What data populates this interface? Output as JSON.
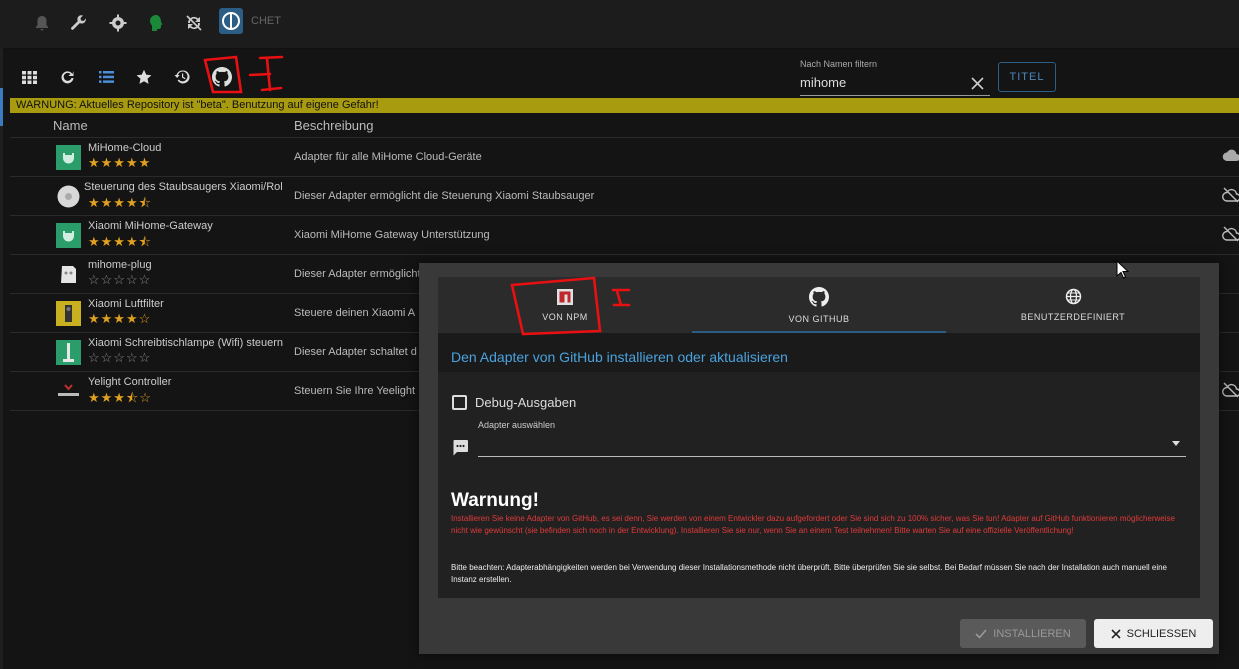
{
  "topbar": {
    "icons": [
      "bell-icon",
      "wrench-icon",
      "gear-icon",
      "hazard-icon",
      "sync-icon"
    ],
    "logo_text": "CHET"
  },
  "toolbar": {
    "icons": [
      "grid-icon",
      "refresh-icon",
      "list-icon",
      "star-icon",
      "history-icon",
      "github-icon"
    ],
    "filter_label": "Nach Namen filtern",
    "filter_value": "mihome",
    "title_button": "TITEL"
  },
  "warning_bar": "WARNUNG: Aktuelles Repository ist \"beta\". Benutzung auf eigene Gefahr!",
  "table": {
    "headers": {
      "name": "Name",
      "description": "Beschreibung"
    },
    "rows": [
      {
        "name": "MiHome-Cloud",
        "rating": 5.0,
        "stars": "★★★★★",
        "description": "Adapter für alle MiHome Cloud-Geräte",
        "icon": "mihome-icon",
        "cloud": "cloud-icon"
      },
      {
        "name": "Steuerung des Staubsaugers Xiaomi/Rol",
        "rating": 4.5,
        "stars": "★★★★⯪",
        "description": "Dieser Adapter ermöglicht die Steuerung Xiaomi Staubsauger",
        "icon": "vacuum-icon",
        "cloud": "cloud-off-icon"
      },
      {
        "name": "Xiaomi MiHome-Gateway",
        "rating": 4.5,
        "stars": "★★★★⯪",
        "description": "Xiaomi MiHome Gateway Unterstützung",
        "icon": "mihome-icon",
        "cloud": "cloud-off-icon"
      },
      {
        "name": "mihome-plug",
        "rating": 0,
        "stars": "☆☆☆☆☆",
        "description": "Dieser Adapter ermöglicht",
        "icon": "plug-icon",
        "cloud": ""
      },
      {
        "name": "Xiaomi Luftfilter",
        "rating": 4.0,
        "stars": "★★★★☆",
        "description": "Steuere deinen Xiaomi A",
        "icon": "airfilter-icon",
        "cloud": ""
      },
      {
        "name": "Xiaomi Schreibtischlampe (Wifi) steuern",
        "rating": 0,
        "stars": "☆☆☆☆☆",
        "description": "Dieser Adapter schaltet d",
        "icon": "lamp-icon",
        "cloud": ""
      },
      {
        "name": "Yelight Controller",
        "rating": 3.5,
        "stars": "★★★⯪☆",
        "description": "Steuern Sie Ihre Yeelight",
        "icon": "yeelight-icon",
        "cloud": "cloud-off-icon"
      }
    ]
  },
  "dialog": {
    "tabs": [
      {
        "label": "VON NPM",
        "icon": "npm-icon"
      },
      {
        "label": "VON GITHUB",
        "icon": "github-icon"
      },
      {
        "label": "BENUTZERDEFINIERT",
        "icon": "globe-icon"
      }
    ],
    "active_tab": "VON GITHUB",
    "heading": "Den Adapter von GitHub installieren oder aktualisieren",
    "debug_label": "Debug-Ausgaben",
    "select_label": "Adapter auswählen",
    "select_value": "",
    "warning_title": "Warnung!",
    "warning_text": "Installieren Sie keine Adapter von GitHub, es sei denn, Sie werden von einem Entwickler dazu aufgefordert oder Sie sind sich zu 100% sicher, was Sie tun! Adapter auf GitHub funktionieren möglicherweise nicht wie gewünscht (sie befinden sich noch in der Entwicklung). Installieren Sie sie nur, wenn Sie an einem Test teilnehmen! Bitte warten Sie auf eine offizielle Veröffentlichung!",
    "note_text": "Bitte beachten: Adapterabhängigkeiten werden bei Verwendung dieser Installationsmethode nicht überprüft. Bitte überprüfen Sie sie selbst. Bei Bedarf müssen Sie nach der Installation auch manuell eine Instanz erstellen.",
    "install_button": "INSTALLIEREN",
    "close_button": "SCHLIESSEN"
  },
  "colors": {
    "accent": "#4aa3df",
    "star": "#e0a020",
    "warning_bar": "#a89b10",
    "annotation": "#e81010"
  }
}
